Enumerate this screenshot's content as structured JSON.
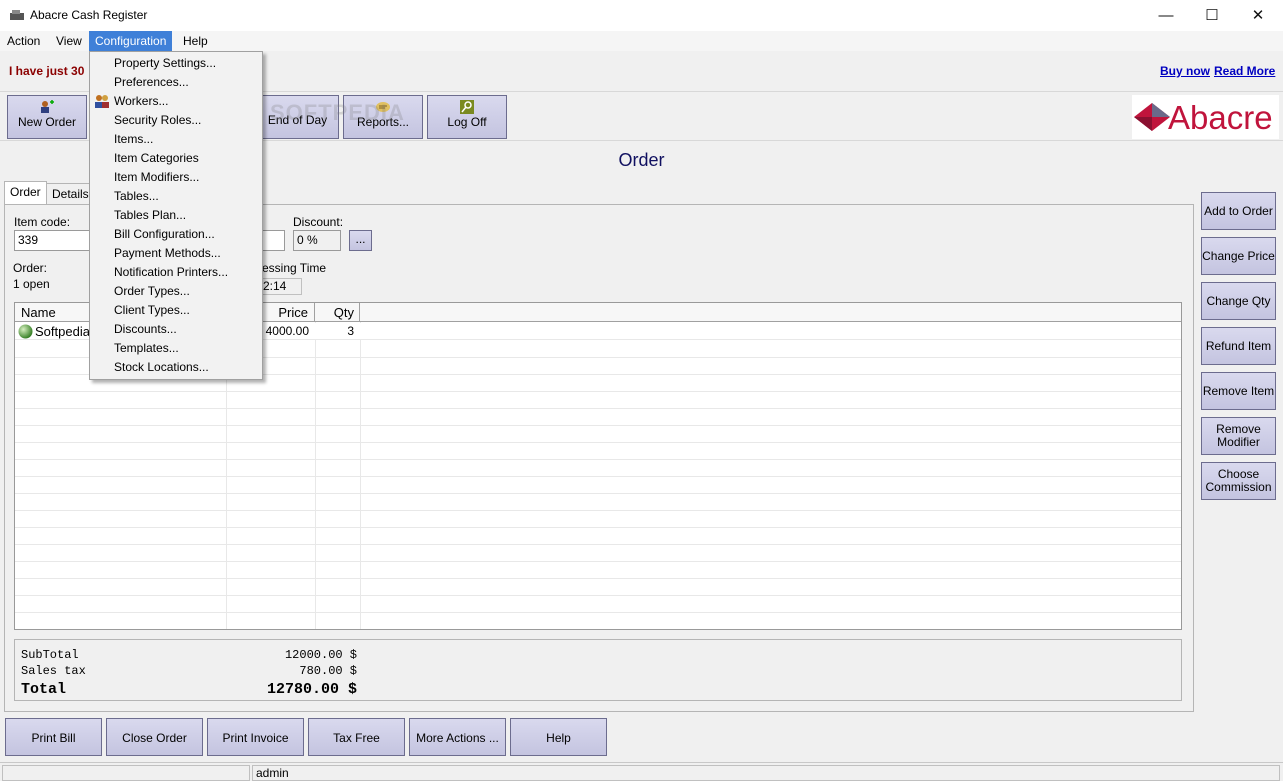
{
  "window": {
    "title": "Abacre Cash Register"
  },
  "menu": {
    "items": [
      "Action",
      "View",
      "Configuration",
      "Help"
    ],
    "active": "Configuration"
  },
  "promo": {
    "text": "I have just 30",
    "links": [
      "Buy now",
      "Read More"
    ]
  },
  "toolbar": {
    "buttons": [
      {
        "label": "New Order",
        "icon": "new-order-icon"
      },
      {
        "label": "End of Day",
        "icon": "none"
      },
      {
        "label": "Reports...",
        "icon": "reports-icon"
      },
      {
        "label": "Log Off",
        "icon": "key-icon"
      }
    ]
  },
  "logo": {
    "text": "Abacre"
  },
  "watermark": "SOFTPEDIA",
  "order": {
    "heading": "Order",
    "tabs": [
      "Order",
      "Details"
    ],
    "item_code_label": "Item code:",
    "item_code_value": "339",
    "discount_label": "Discount:",
    "discount_value": "0 %",
    "discount_button": "...",
    "order_label": "Order:",
    "order_value": "1 open",
    "processing_label": "essing Time",
    "processing_value": "2:14"
  },
  "grid": {
    "columns": [
      "Name",
      "Price",
      "Qty"
    ],
    "rows": [
      {
        "name": "Softpedia",
        "price": "4000.00",
        "qty": "3"
      }
    ]
  },
  "totals": {
    "subtotal_label": "SubTotal",
    "subtotal_value": "12000.00 $",
    "tax_label": "Sales tax",
    "tax_value": "780.00 $",
    "total_label": "Total",
    "total_value": "12780.00 $"
  },
  "right_buttons": [
    "Add to Order",
    "Change Price",
    "Change Qty",
    "Refund Item",
    "Remove Item",
    "Remove Modifier",
    "Choose Commission"
  ],
  "bottom_buttons": [
    "Print Bill",
    "Close Order",
    "Print Invoice",
    "Tax Free",
    "More Actions ...",
    "Help"
  ],
  "status": {
    "user": "admin"
  },
  "configuration_menu": [
    "Property Settings...",
    "Preferences...",
    "Workers...",
    "Security Roles...",
    "Items...",
    "Item Categories",
    "Item Modifiers...",
    "Tables...",
    "Tables Plan...",
    "Bill Configuration...",
    "Payment Methods...",
    "Notification Printers...",
    "Order Types...",
    "Client Types...",
    "Discounts...",
    "Templates...",
    "Stock Locations..."
  ],
  "colors": {
    "button_face": "#c8c8e4",
    "menu_highlight": "#3f80d8",
    "promo_text": "#8b0000",
    "link": "#0000c0",
    "heading": "#101060",
    "logo_red": "#c0143c"
  }
}
